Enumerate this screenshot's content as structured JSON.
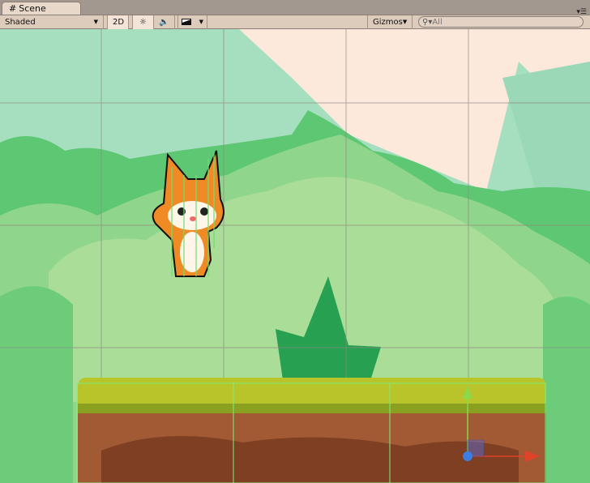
{
  "tab": {
    "icon": "grid-icon",
    "label": "Scene"
  },
  "toolbar": {
    "draw_mode": "Shaded",
    "mode_2d": "2D",
    "lighting_icon": "sun-icon",
    "audio_icon": "speaker-icon",
    "effects_icon": "image-icon",
    "gizmos": "Gizmos",
    "search_placeholder": "All"
  },
  "colors": {
    "sky": "#a6dfbf",
    "peach": "#fde9dc",
    "bush_dark": "#5dc774",
    "bush_light": "#a9dd98",
    "grass": "#b8c42a",
    "dirt": "#a25a35"
  }
}
